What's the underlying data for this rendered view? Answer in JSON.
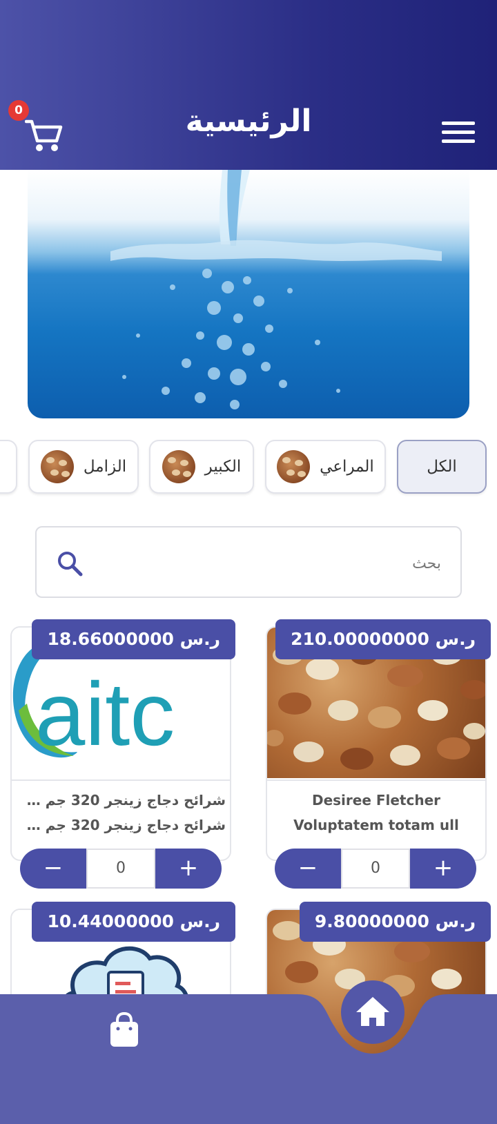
{
  "header": {
    "title": "الرئيسية",
    "cart_count": "0",
    "cart_icon": "cart-icon",
    "menu_icon": "menu-icon"
  },
  "banner": {
    "image": "water-splash-banner"
  },
  "categories": [
    {
      "label": "الكل",
      "active": true
    },
    {
      "label": "المراعي",
      "active": false
    },
    {
      "label": "الكبير",
      "active": false
    },
    {
      "label": "الزامل",
      "active": false
    }
  ],
  "search": {
    "placeholder": "بحث",
    "icon": "search-icon"
  },
  "products": [
    {
      "price": "210.00000000 ر.س",
      "name_line1": "Desiree Fletcher",
      "name_line2": "Voluptatem totam ull",
      "quantity": "0",
      "minus": "−",
      "plus": "+"
    },
    {
      "price": "18.66000000 ر.س",
      "name_line1": "شرائح دجاج زينجر 320 جم ×...",
      "name_line2": "شرائح دجاج زينجر 320 جم ×...",
      "logo_text": "aitc",
      "quantity": "0",
      "minus": "−",
      "plus": "+"
    },
    {
      "price": "9.80000000 ر.س"
    },
    {
      "price": "10.44000000 ر.س"
    }
  ],
  "bottom_nav": {
    "home_icon": "home-icon",
    "bag_icon": "shopping-bag-icon"
  },
  "colors": {
    "primary": "#4a4fa6",
    "header_dark": "#1f2278",
    "badge": "#e53935"
  }
}
